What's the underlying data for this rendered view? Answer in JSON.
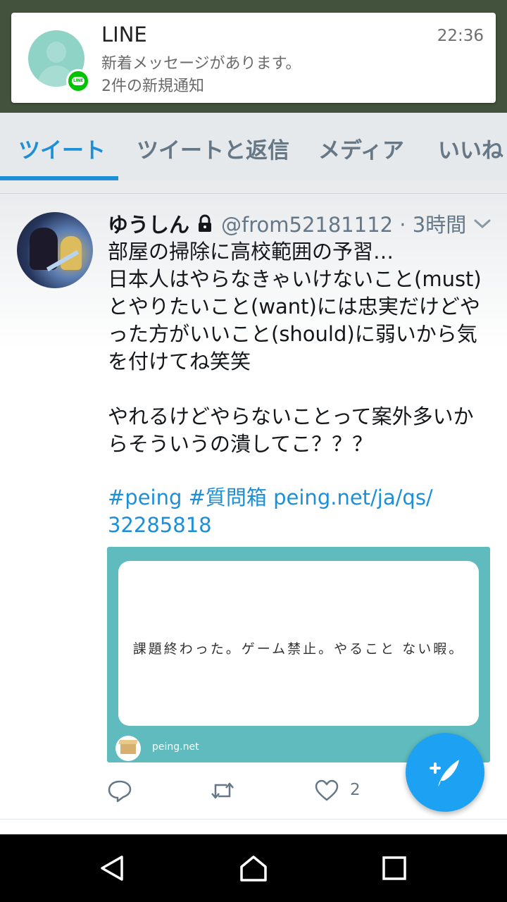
{
  "notification": {
    "app": "LINE",
    "time": "22:36",
    "line1": "新着メッセージがあります。",
    "line2": "2件の新規通知",
    "badge_text": "LINE",
    "badge_color": "#00c300"
  },
  "tabs": [
    {
      "label": "ツイート",
      "active": true
    },
    {
      "label": "ツイートと返信",
      "active": false
    },
    {
      "label": "メディア",
      "active": false
    },
    {
      "label": "いいね",
      "active": false
    }
  ],
  "tweet": {
    "name": "ゆうしん",
    "handle_time": "@from52181112 · 3時間",
    "text_lines": [
      "部屋の掃除に高校範囲の予習…",
      "日本人はやらなきゃいけないこと(must)",
      "とやりたいこと(want)には忠実だけどや",
      "った方がいいこと(should)に弱いから気",
      "を付けてね笑笑",
      "",
      "やれるけどやらないことって案外多いか",
      "らそういうの潰してこ？？？"
    ],
    "link_line1": "#peing #質問箱 peing.net/ja/qs/",
    "link_line2": "32285818",
    "card": {
      "question": "課題終わった。ゲーム禁止。やること ない暇。",
      "site": "peing.net"
    },
    "like_count": "2"
  },
  "colors": {
    "accent": "#1d8fd6",
    "fab": "#1da1f2",
    "card_bg": "#5fbbbd"
  },
  "icons": {
    "reply": "reply-icon",
    "retweet": "retweet-icon",
    "like": "heart-icon",
    "compose": "compose-tweet-icon",
    "lock": "lock-icon"
  }
}
